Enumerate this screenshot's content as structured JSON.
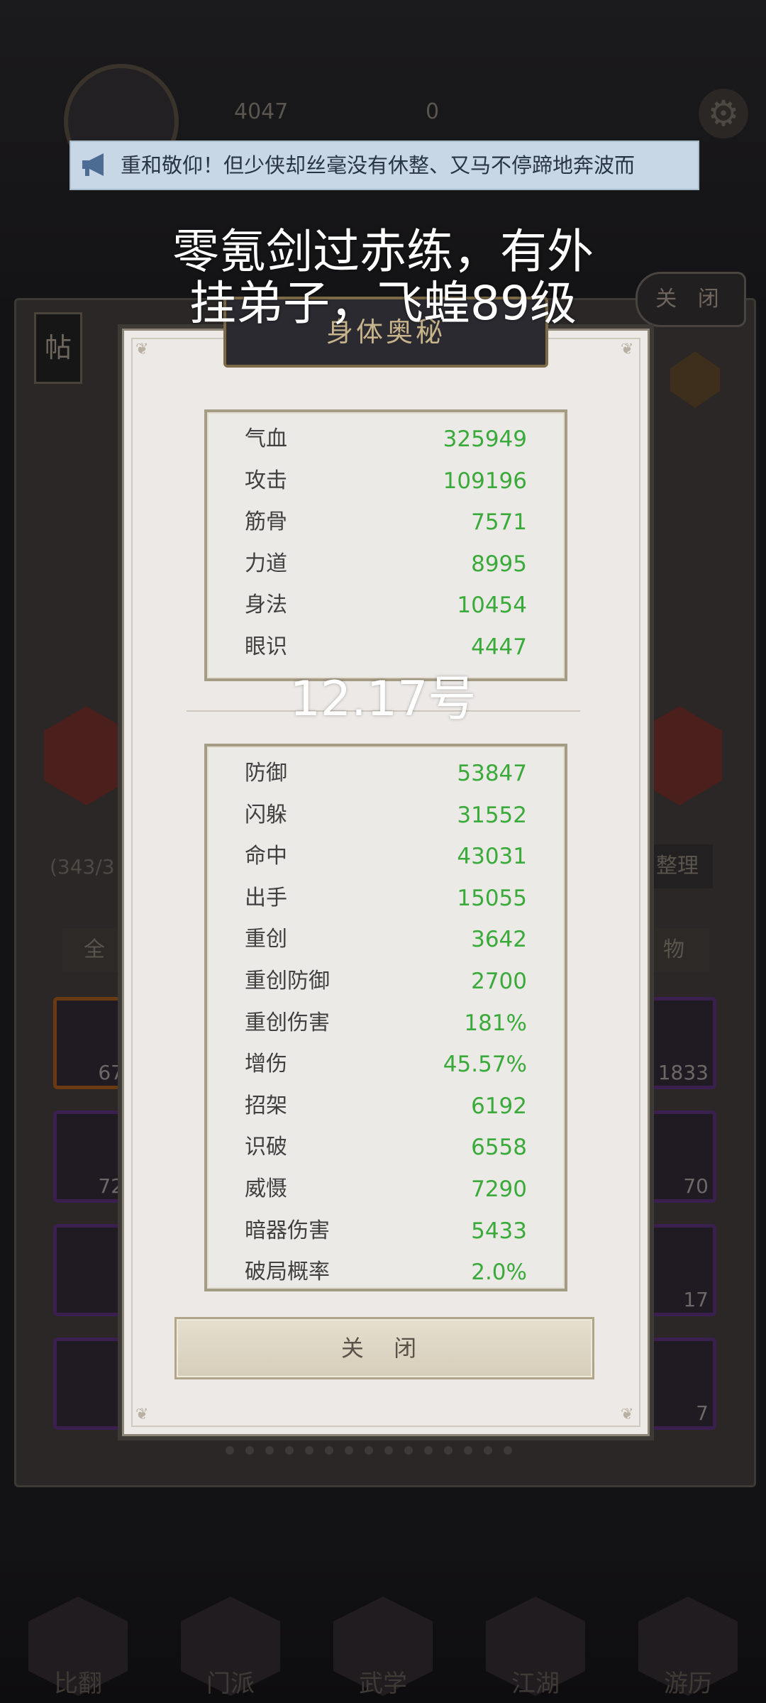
{
  "background": {
    "gold_amount": "4047",
    "gems_amount": "0",
    "tie_label": "帖",
    "close_label": "关 闭",
    "count_text": "(343/3",
    "sort_label": "整理",
    "tab_left": "全",
    "tab_right": "物",
    "slot_counts": [
      "67",
      "1833",
      "72",
      "70",
      "17",
      "7"
    ],
    "nav_labels": [
      "比翻",
      "门派",
      "武学",
      "江湖",
      "游历"
    ]
  },
  "marquee": {
    "text": "重和敬仰！但少侠却丝毫没有休整、又马不停蹄地奔波而",
    "icon": "megaphone-icon"
  },
  "overlay": {
    "line1": "零氪剑过赤练，有外",
    "line2": "挂弟子，飞蝗89级",
    "date": "12.17号"
  },
  "modal": {
    "title": "身体奥秘",
    "close_label": "关 闭",
    "basic_stats": [
      {
        "name": "气血",
        "value": "325949"
      },
      {
        "name": "攻击",
        "value": "109196"
      },
      {
        "name": "筋骨",
        "value": "7571"
      },
      {
        "name": "力道",
        "value": "8995"
      },
      {
        "name": "身法",
        "value": "10454"
      },
      {
        "name": "眼识",
        "value": "4447"
      }
    ],
    "advanced_stats": [
      {
        "name": "防御",
        "value": "53847"
      },
      {
        "name": "闪躲",
        "value": "31552"
      },
      {
        "name": "命中",
        "value": "43031"
      },
      {
        "name": "出手",
        "value": "15055"
      },
      {
        "name": "重创",
        "value": "3642"
      },
      {
        "name": "重创防御",
        "value": "2700"
      },
      {
        "name": "重创伤害",
        "value": "181%"
      },
      {
        "name": "增伤",
        "value": "45.57%"
      },
      {
        "name": "招架",
        "value": "6192"
      },
      {
        "name": "识破",
        "value": "6558"
      },
      {
        "name": "威慑",
        "value": "7290"
      },
      {
        "name": "暗器伤害",
        "value": "5433"
      },
      {
        "name": "破局概率",
        "value": "2.0%"
      }
    ]
  },
  "colors": {
    "stat_value_green": "#3aaa3a",
    "modal_background": "#ece9e6",
    "title_plate": "#2a2a30",
    "marquee_background": "#c8d7e5"
  }
}
